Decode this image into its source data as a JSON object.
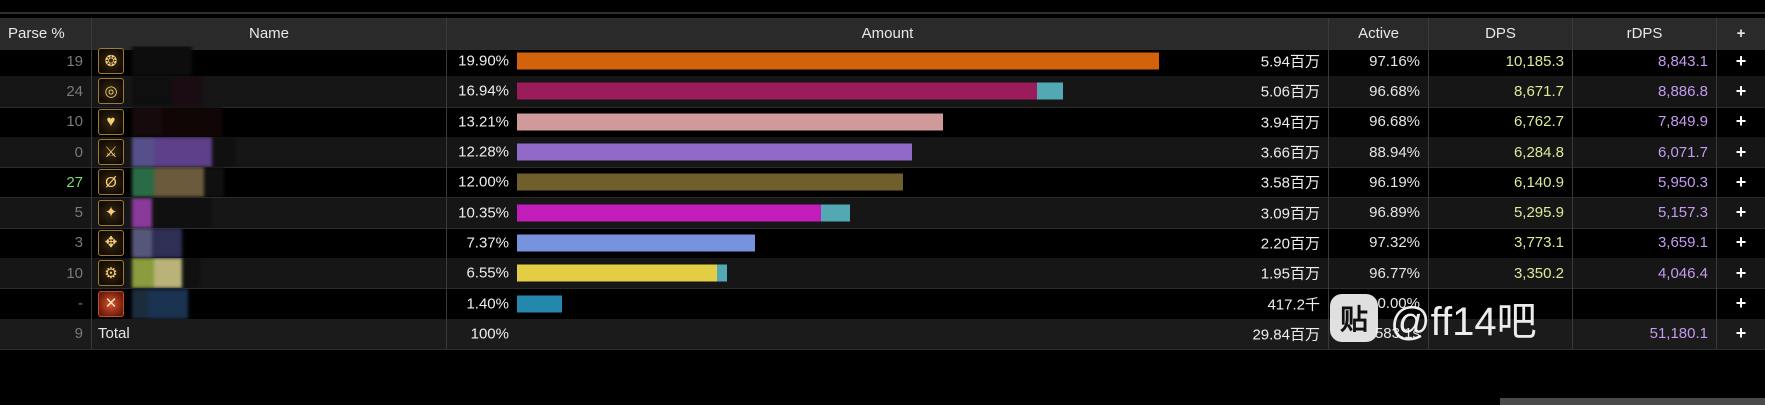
{
  "headers": {
    "parse": "Parse %",
    "name": "Name",
    "amount": "Amount",
    "active": "Active",
    "dps": "DPS",
    "rdps": "rDPS",
    "plus": "+"
  },
  "colors": {
    "dps_text": "#d9ec9a",
    "rdps_text": "#c39bf0",
    "parse_default": "#7b7b7b",
    "parse_good": "#7fd37a",
    "secondary_bar": "#53a9b3"
  },
  "rows": [
    {
      "parse": "19",
      "icon": "job-icon-astrologian",
      "glyph": "❂",
      "pct": "19.90%",
      "amount": "5.94百万",
      "active": "97.16%",
      "dps": "10,185.3",
      "rdps": "8,843.1",
      "plus": "+",
      "bar_color": "#d2620c",
      "bar_fraction": 1.0,
      "extra_fraction": 0.0
    },
    {
      "parse": "24",
      "icon": "job-icon-sage",
      "glyph": "◎",
      "pct": "16.94%",
      "amount": "5.06百万",
      "active": "96.68%",
      "dps": "8,671.7",
      "rdps": "8,886.8",
      "plus": "+",
      "bar_color": "#9a1c5b",
      "bar_fraction": 0.81,
      "extra_fraction": 0.04
    },
    {
      "parse": "10",
      "icon": "job-icon-paladin",
      "glyph": "♥",
      "pct": "13.21%",
      "amount": "3.94百万",
      "active": "96.68%",
      "dps": "6,762.7",
      "rdps": "7,849.9",
      "plus": "+",
      "bar_color": "#d19a9a",
      "bar_fraction": 0.663,
      "extra_fraction": 0.0
    },
    {
      "parse": "0",
      "icon": "job-icon-dark-knight",
      "glyph": "⚔",
      "pct": "12.28%",
      "amount": "3.66百万",
      "active": "88.94%",
      "dps": "6,284.8",
      "rdps": "6,071.7",
      "plus": "+",
      "bar_color": "#9169c8",
      "bar_fraction": 0.616,
      "extra_fraction": 0.0
    },
    {
      "parse": "27",
      "icon": "job-icon-reaper",
      "glyph": "Ø",
      "pct": "12.00%",
      "amount": "3.58百万",
      "active": "96.19%",
      "dps": "6,140.9",
      "rdps": "5,950.3",
      "plus": "+",
      "bar_color": "#6e5f2c",
      "bar_fraction": 0.602,
      "extra_fraction": 0.0
    },
    {
      "parse": "5",
      "icon": "job-icon-dancer",
      "glyph": "✦",
      "pct": "10.35%",
      "amount": "3.09百万",
      "active": "96.89%",
      "dps": "5,295.9",
      "rdps": "5,157.3",
      "plus": "+",
      "bar_color": "#c21db8",
      "bar_fraction": 0.474,
      "extra_fraction": 0.045
    },
    {
      "parse": "3",
      "icon": "job-icon-white-mage",
      "glyph": "✥",
      "pct": "7.37%",
      "amount": "2.20百万",
      "active": "97.32%",
      "dps": "3,773.1",
      "rdps": "3,659.1",
      "plus": "+",
      "bar_color": "#7793de",
      "bar_fraction": 0.37,
      "extra_fraction": 0.0
    },
    {
      "parse": "10",
      "icon": "job-icon-machinist",
      "glyph": "⚙",
      "pct": "6.55%",
      "amount": "1.95百万",
      "active": "96.77%",
      "dps": "3,350.2",
      "rdps": "4,046.4",
      "plus": "+",
      "bar_color": "#e3cd45",
      "bar_fraction": 0.311,
      "extra_fraction": 0.016
    },
    {
      "parse": "-",
      "icon": "limit-break-icon",
      "glyph": "✕",
      "pct": "1.40%",
      "amount": "417.2千",
      "active": "0.00%",
      "dps": "",
      "rdps": "",
      "plus": "+",
      "bar_color": "#2388ab",
      "bar_fraction": 0.07,
      "extra_fraction": 0.0
    }
  ],
  "total": {
    "parse": "9",
    "name": "Total",
    "pct": "100%",
    "amount": "29.84百万",
    "active": "583.1s",
    "dps": "",
    "rdps": "51,180.1",
    "plus": "+"
  },
  "watermark": {
    "logo": "贴",
    "text": "@ff14吧"
  }
}
